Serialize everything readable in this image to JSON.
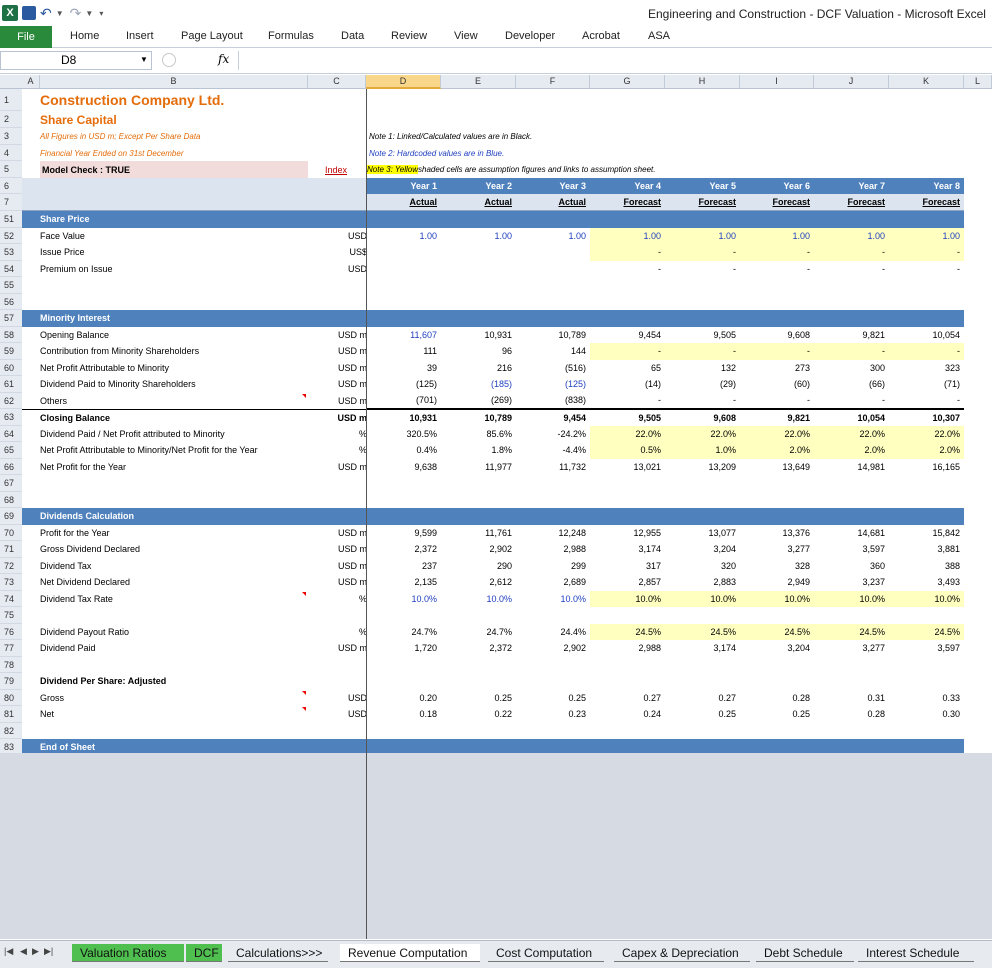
{
  "window": {
    "title": "Engineering and Construction - DCF Valuation  -  Microsoft Excel",
    "app_icon": "excel-logo-icon"
  },
  "ribbon": {
    "file": "File",
    "tabs": [
      "Home",
      "Insert",
      "Page Layout",
      "Formulas",
      "Data",
      "Review",
      "View",
      "Developer",
      "Acrobat",
      "ASA"
    ]
  },
  "formula_bar": {
    "name_box": "D8",
    "fx": "fx",
    "value": ""
  },
  "columns": [
    "A",
    "B",
    "C",
    "D",
    "E",
    "F",
    "G",
    "H",
    "I",
    "J",
    "K",
    "L"
  ],
  "selected_column": "D",
  "sheet": {
    "title": "Construction Company Ltd.",
    "subtitle": "Share Capital",
    "note_line1": "All Figures in USD m; Except Per Share Data",
    "note_line2": "Financial Year Ended on 31st December",
    "model_check": "Model Check : TRUE",
    "index_link": "Index",
    "note1": "Note 1: Linked/Calculated values are in Black.",
    "note2": "Note 2: Hardcoded values are in Blue.",
    "note3_hl": "Note 3: Yellow ",
    "note3_rest": "shaded cells are assumption figures and links to assumption sheet.",
    "years": [
      "Year 1",
      "Year 2",
      "Year 3",
      "Year 4",
      "Year 5",
      "Year 6",
      "Year 7",
      "Year 8"
    ],
    "periods": [
      "Actual",
      "Actual",
      "Actual",
      "Forecast",
      "Forecast",
      "Forecast",
      "Forecast",
      "Forecast"
    ]
  },
  "rows": [
    {
      "n": "51",
      "label": "Share Price",
      "type": "band"
    },
    {
      "n": "52",
      "label": "Face Value",
      "unit": "USD",
      "values": [
        "1.00",
        "1.00",
        "1.00",
        "1.00",
        "1.00",
        "1.00",
        "1.00",
        "1.00"
      ],
      "blue": [
        1,
        1,
        1,
        1,
        1,
        1,
        1,
        1
      ],
      "yellow": [
        0,
        0,
        0,
        1,
        1,
        1,
        1,
        1
      ]
    },
    {
      "n": "53",
      "label": "Issue Price",
      "unit": "US$",
      "values": [
        "",
        "",
        "",
        "-",
        "-",
        "-",
        "-",
        "-"
      ],
      "yellow": [
        0,
        0,
        0,
        1,
        1,
        1,
        1,
        1
      ]
    },
    {
      "n": "54",
      "label": "Premium on Issue",
      "unit": "USD",
      "values": [
        "",
        "",
        "",
        "-",
        "-",
        "-",
        "-",
        "-"
      ]
    },
    {
      "n": "55",
      "label": ""
    },
    {
      "n": "56",
      "label": ""
    },
    {
      "n": "57",
      "label": "Minority Interest",
      "type": "band"
    },
    {
      "n": "58",
      "label": "Opening Balance",
      "unit": "USD m",
      "values": [
        "11,607",
        "10,931",
        "10,789",
        "9,454",
        "9,505",
        "9,608",
        "9,821",
        "10,054"
      ],
      "blue": [
        1,
        0,
        0,
        0,
        0,
        0,
        0,
        0
      ]
    },
    {
      "n": "59",
      "label": "Contribution from Minority Shareholders",
      "unit": "USD m",
      "values": [
        "111",
        "96",
        "144",
        "-",
        "-",
        "-",
        "-",
        "-"
      ],
      "yellow": [
        0,
        0,
        0,
        1,
        1,
        1,
        1,
        1
      ]
    },
    {
      "n": "60",
      "label": "Net Profit Attributable to Minority",
      "unit": "USD m",
      "values": [
        "39",
        "216",
        "(516)",
        "65",
        "132",
        "273",
        "300",
        "323"
      ]
    },
    {
      "n": "61",
      "label": "Dividend Paid to Minority Shareholders",
      "unit": "USD m",
      "values": [
        "(125)",
        "(185)",
        "(125)",
        "(14)",
        "(29)",
        "(60)",
        "(66)",
        "(71)"
      ],
      "blue": [
        0,
        1,
        1,
        0,
        0,
        0,
        0,
        0
      ]
    },
    {
      "n": "62",
      "label": "Others",
      "unit": "USD m",
      "values": [
        "(701)",
        "(269)",
        "(838)",
        "-",
        "-",
        "-",
        "-",
        "-"
      ],
      "underline": true,
      "comment": true
    },
    {
      "n": "63",
      "label": "Closing Balance",
      "unit": "USD m",
      "values": [
        "10,931",
        "10,789",
        "9,454",
        "9,505",
        "9,608",
        "9,821",
        "10,054",
        "10,307"
      ],
      "bold": true
    },
    {
      "n": "64",
      "label": "Dividend Paid / Net Profit attributed to Minority",
      "unit": "%",
      "values": [
        "320.5%",
        "85.6%",
        "-24.2%",
        "22.0%",
        "22.0%",
        "22.0%",
        "22.0%",
        "22.0%"
      ],
      "yellow": [
        0,
        0,
        0,
        1,
        1,
        1,
        1,
        1
      ]
    },
    {
      "n": "65",
      "label": "Net Profit Attributable to Minority/Net Profit for the Year",
      "unit": "%",
      "values": [
        "0.4%",
        "1.8%",
        "-4.4%",
        "0.5%",
        "1.0%",
        "2.0%",
        "2.0%",
        "2.0%"
      ],
      "yellow": [
        0,
        0,
        0,
        1,
        1,
        1,
        1,
        1
      ]
    },
    {
      "n": "66",
      "label": "Net Profit for the Year",
      "unit": "USD m",
      "values": [
        "9,638",
        "11,977",
        "11,732",
        "13,021",
        "13,209",
        "13,649",
        "14,981",
        "16,165"
      ]
    },
    {
      "n": "67",
      "label": ""
    },
    {
      "n": "68",
      "label": ""
    },
    {
      "n": "69",
      "label": "Dividends Calculation",
      "type": "band"
    },
    {
      "n": "70",
      "label": "Profit for the Year",
      "unit": "USD m",
      "values": [
        "9,599",
        "11,761",
        "12,248",
        "12,955",
        "13,077",
        "13,376",
        "14,681",
        "15,842"
      ]
    },
    {
      "n": "71",
      "label": "Gross Dividend Declared",
      "unit": "USD m",
      "values": [
        "2,372",
        "2,902",
        "2,988",
        "3,174",
        "3,204",
        "3,277",
        "3,597",
        "3,881"
      ]
    },
    {
      "n": "72",
      "label": "Dividend Tax",
      "unit": "USD m",
      "values": [
        "237",
        "290",
        "299",
        "317",
        "320",
        "328",
        "360",
        "388"
      ]
    },
    {
      "n": "73",
      "label": "Net Dividend Declared",
      "unit": "USD m",
      "values": [
        "2,135",
        "2,612",
        "2,689",
        "2,857",
        "2,883",
        "2,949",
        "3,237",
        "3,493"
      ]
    },
    {
      "n": "74",
      "label": "Dividend Tax Rate",
      "unit": "%",
      "values": [
        "10.0%",
        "10.0%",
        "10.0%",
        "10.0%",
        "10.0%",
        "10.0%",
        "10.0%",
        "10.0%"
      ],
      "blue": [
        1,
        1,
        1,
        0,
        0,
        0,
        0,
        0
      ],
      "yellow": [
        0,
        0,
        0,
        1,
        1,
        1,
        1,
        1
      ],
      "comment": true
    },
    {
      "n": "75",
      "label": ""
    },
    {
      "n": "76",
      "label": "Dividend Payout Ratio",
      "unit": "%",
      "values": [
        "24.7%",
        "24.7%",
        "24.4%",
        "24.5%",
        "24.5%",
        "24.5%",
        "24.5%",
        "24.5%"
      ],
      "yellow": [
        0,
        0,
        0,
        1,
        1,
        1,
        1,
        1
      ]
    },
    {
      "n": "77",
      "label": "Dividend Paid",
      "unit": "USD m",
      "values": [
        "1,720",
        "2,372",
        "2,902",
        "2,988",
        "3,174",
        "3,204",
        "3,277",
        "3,597"
      ]
    },
    {
      "n": "78",
      "label": ""
    },
    {
      "n": "79",
      "label": "Dividend Per Share: Adjusted",
      "bold": true
    },
    {
      "n": "80",
      "label": "Gross",
      "unit": "USD",
      "values": [
        "0.20",
        "0.25",
        "0.25",
        "0.27",
        "0.27",
        "0.28",
        "0.31",
        "0.33"
      ],
      "comment": true
    },
    {
      "n": "81",
      "label": "Net",
      "unit": "USD",
      "values": [
        "0.18",
        "0.22",
        "0.23",
        "0.24",
        "0.25",
        "0.25",
        "0.28",
        "0.30"
      ],
      "comment": true
    },
    {
      "n": "82",
      "label": ""
    },
    {
      "n": "83",
      "label": "End of Sheet",
      "type": "band"
    }
  ],
  "sheet_tabs": [
    {
      "label": "Valuation Ratios",
      "style": "green"
    },
    {
      "label": "DCF",
      "style": "green"
    },
    {
      "label": "Calculations>>>",
      "style": "plain"
    },
    {
      "label": "Revenue Computation",
      "style": "plain"
    },
    {
      "label": "Cost Computation",
      "style": "plain"
    },
    {
      "label": "Capex & Depreciation",
      "style": "plain"
    },
    {
      "label": "Debt Schedule",
      "style": "plain"
    },
    {
      "label": "Interest Schedule",
      "style": "plain"
    }
  ],
  "colors": {
    "band": "#4f81bd",
    "accent_orange": "#e46c0a",
    "hardcoded_blue": "#1f3fbf",
    "assumption_yellow": "#ffffc0",
    "file_tab": "#2a8a3c"
  }
}
